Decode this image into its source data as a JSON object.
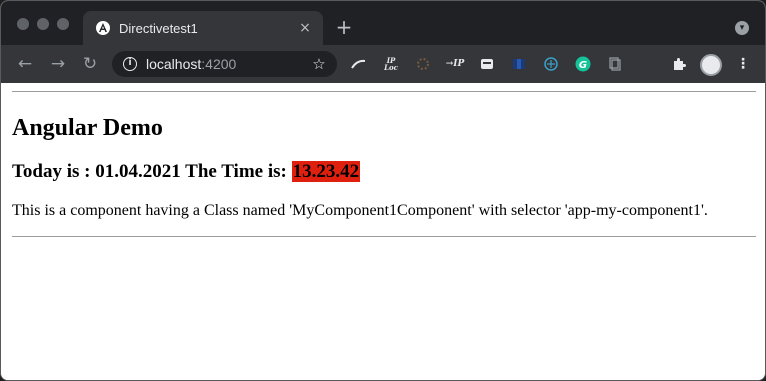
{
  "browser": {
    "tab": {
      "title": "Directivetest1",
      "favicon": "angular-logo-icon",
      "close_glyph": "×"
    },
    "new_tab_glyph": "+",
    "address": {
      "host": "localhost",
      "port": ":4200"
    },
    "extensions": [
      "extension-icon",
      "ip-loc-icon",
      "extension-icon",
      "ip-icon",
      "extension-icon",
      "extension-icon",
      "extension-icon",
      "grammarly-icon",
      "extension-icon"
    ],
    "extension_labels": {
      "ip_loc": "IP\nLoc",
      "ip": "→IP"
    }
  },
  "page": {
    "title": "Angular Demo",
    "date_text": "Today is : 01.04.2021 The Time is: ",
    "time_text": "13.23.42",
    "description": "This is a component having a Class named 'MyComponent1Component' with selector 'app-my-component1'."
  },
  "colors": {
    "time_highlight": "#e0200f",
    "titlebar": "#202124",
    "toolbar": "#35363a"
  }
}
